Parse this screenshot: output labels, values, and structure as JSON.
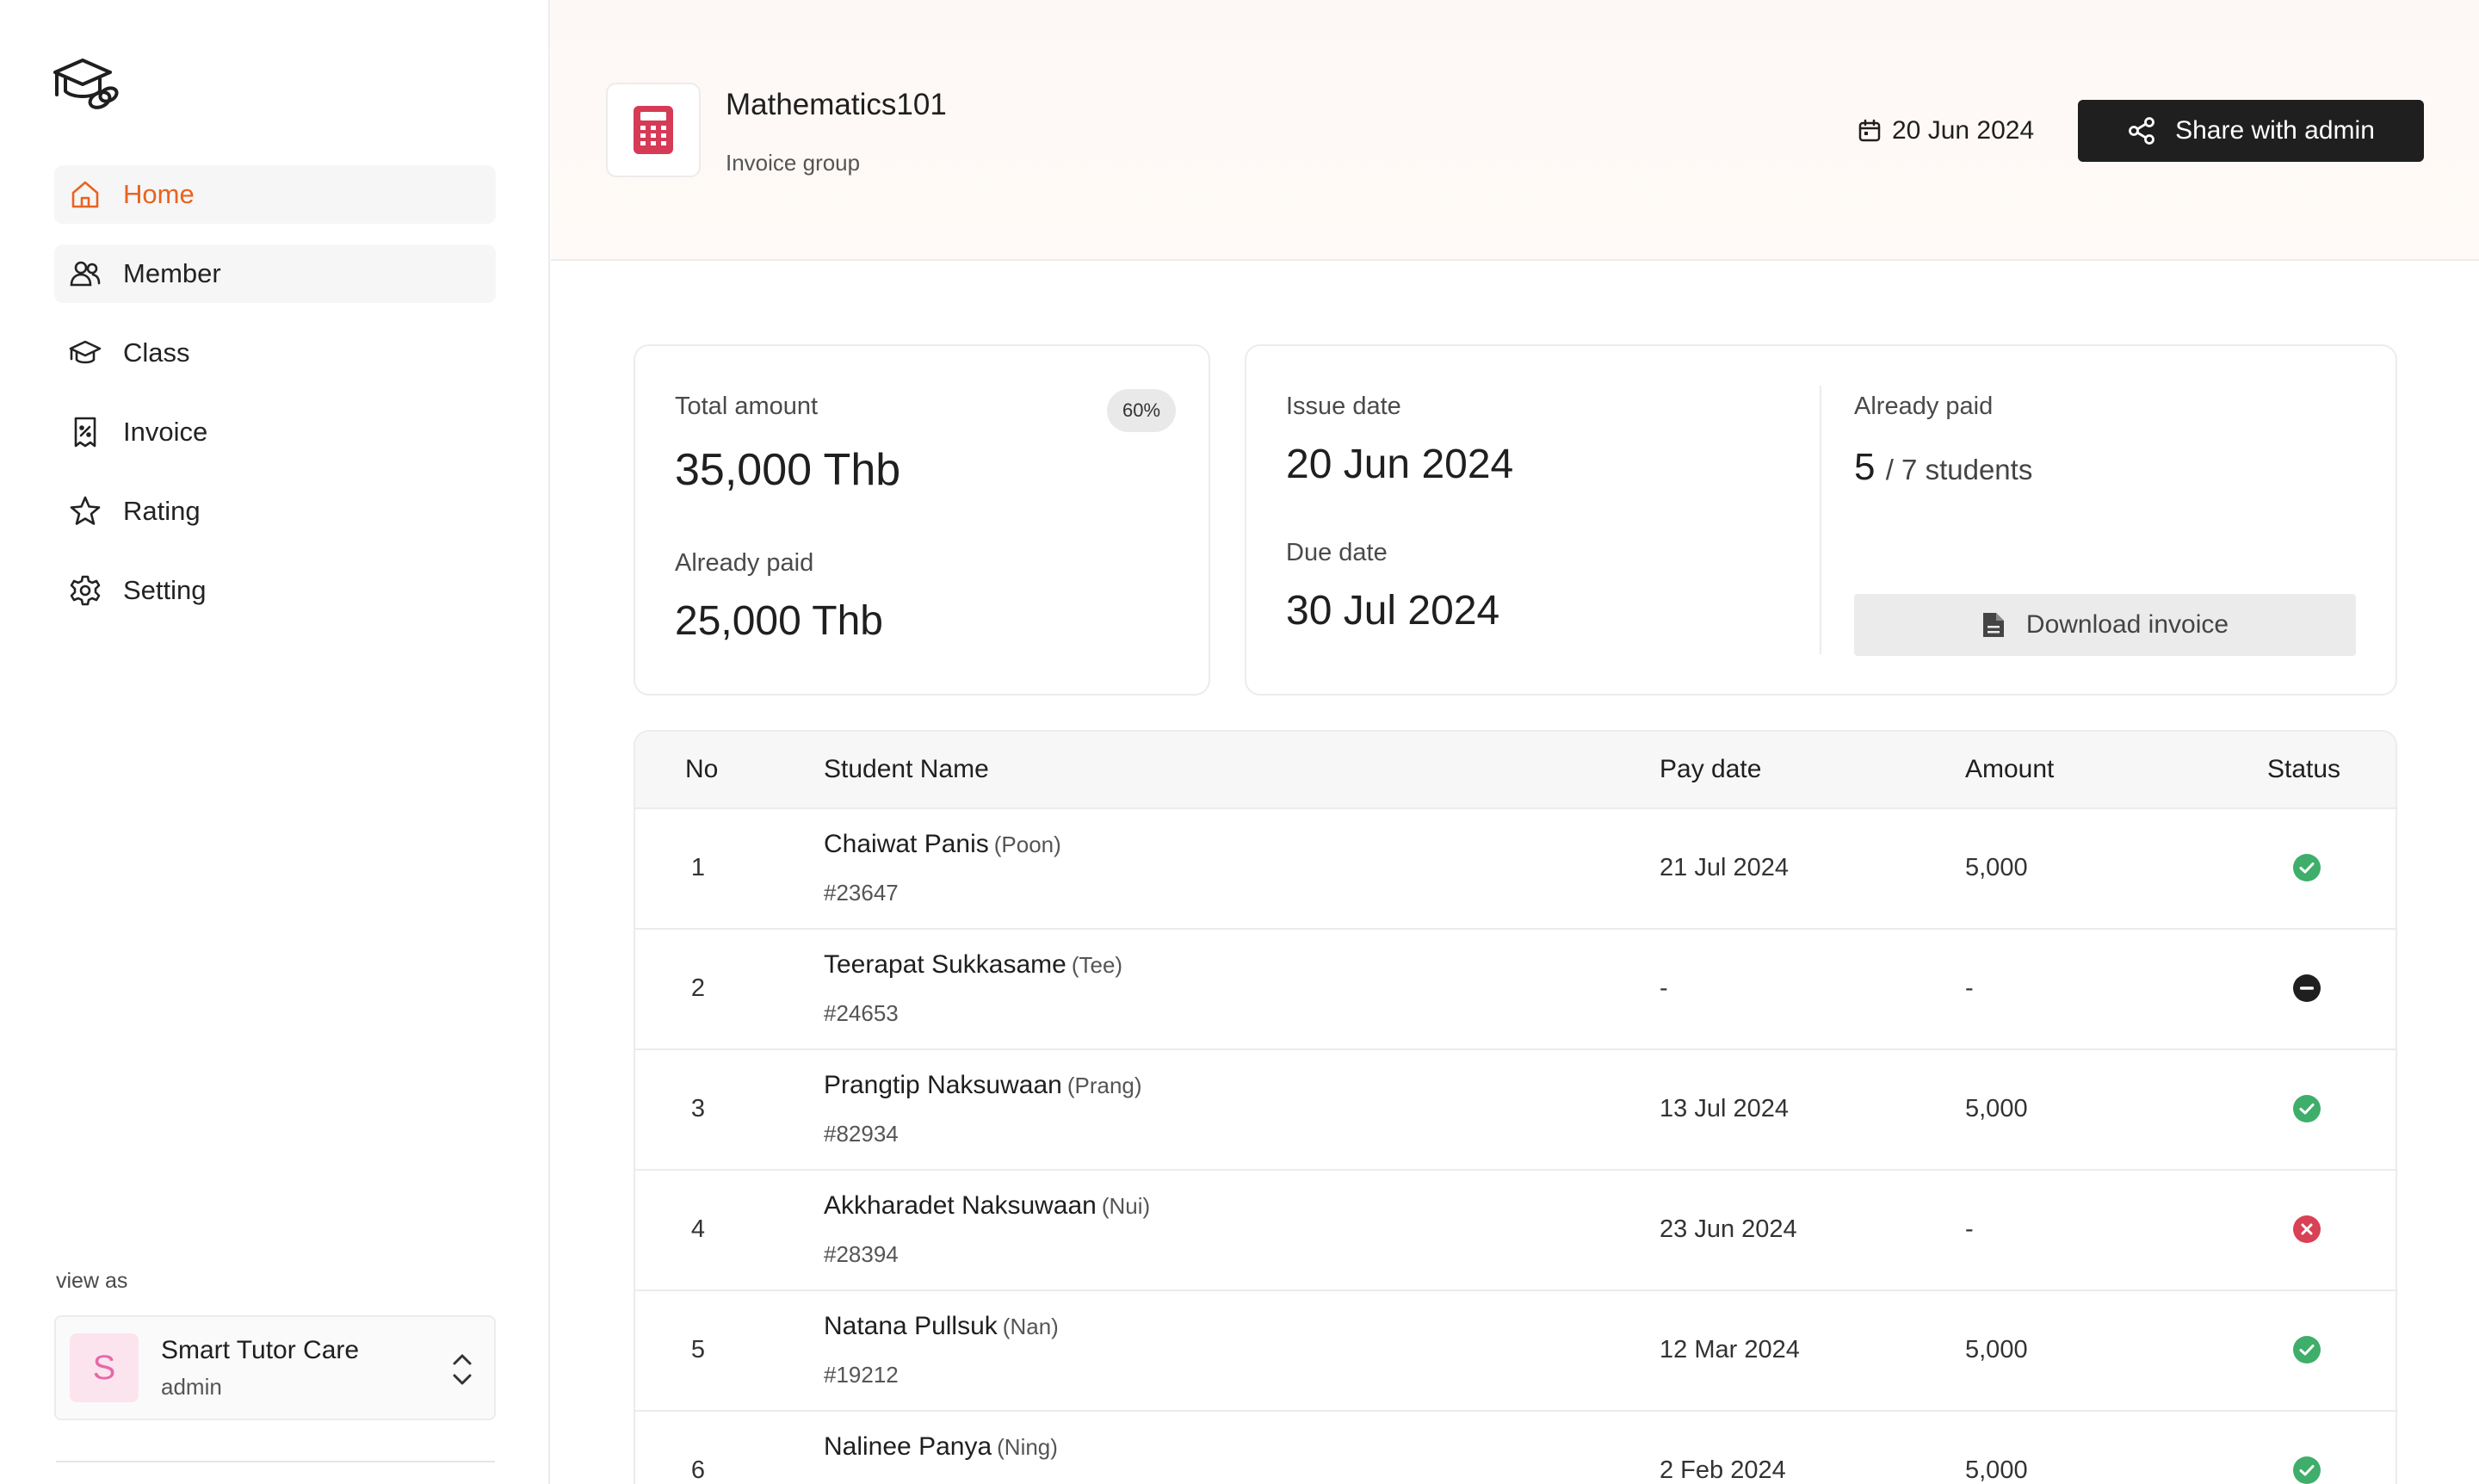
{
  "sidebar": {
    "logo_icon": "graduation-cap-icon",
    "items": [
      {
        "label": "Home",
        "icon": "home-icon",
        "state": "active"
      },
      {
        "label": "Member",
        "icon": "users-icon",
        "state": "hover"
      },
      {
        "label": "Class",
        "icon": "graduation-cap-icon",
        "state": ""
      },
      {
        "label": "Invoice",
        "icon": "receipt-icon",
        "state": ""
      },
      {
        "label": "Rating",
        "icon": "star-icon",
        "state": ""
      },
      {
        "label": "Setting",
        "icon": "gear-icon",
        "state": ""
      }
    ],
    "view_as_label": "view as",
    "account": {
      "initial": "S",
      "name": "Smart Tutor Care",
      "role": "admin"
    }
  },
  "header": {
    "title": "Mathematics101",
    "subtitle": "Invoice group",
    "date": "20 Jun 2024",
    "share_label": "Share with admin"
  },
  "summary": {
    "total_label": "Total amount",
    "percent_badge": "60%",
    "total_value": "35,000 Thb",
    "paid_label": "Already paid",
    "paid_value": "25,000 Thb",
    "issue_label": "Issue date",
    "issue_value": "20 Jun 2024",
    "due_label": "Due date",
    "due_value": "30 Jul 2024",
    "students_label": "Already paid",
    "students_paid": "5",
    "students_suffix": "/ 7 students",
    "download_label": "Download invoice"
  },
  "table": {
    "headers": {
      "no": "No",
      "name": "Student Name",
      "pay_date": "Pay date",
      "amount": "Amount",
      "status": "Status"
    },
    "rows": [
      {
        "no": "1",
        "name": "Chaiwat Panis",
        "nick": "(Poon)",
        "id": "#23647",
        "pay_date": "21 Jul 2024",
        "amount": "5,000",
        "status": "paid"
      },
      {
        "no": "2",
        "name": "Teerapat Sukkasame",
        "nick": "(Tee)",
        "id": "#24653",
        "pay_date": "-",
        "amount": "-",
        "status": "pending"
      },
      {
        "no": "3",
        "name": "Prangtip Naksuwaan",
        "nick": "(Prang)",
        "id": "#82934",
        "pay_date": "13 Jul 2024",
        "amount": "5,000",
        "status": "paid"
      },
      {
        "no": "4",
        "name": "Akkharadet Naksuwaan",
        "nick": "(Nui)",
        "id": "#28394",
        "pay_date": "23 Jun 2024",
        "amount": "-",
        "status": "failed"
      },
      {
        "no": "5",
        "name": "Natana Pullsuk",
        "nick": "(Nan)",
        "id": "#19212",
        "pay_date": "12 Mar 2024",
        "amount": "5,000",
        "status": "paid"
      },
      {
        "no": "6",
        "name": "Nalinee Panya",
        "nick": "(Ning)",
        "id": "",
        "pay_date": "2 Feb 2024",
        "amount": "5,000",
        "status": "paid"
      }
    ]
  },
  "colors": {
    "accent": "#e8631f",
    "brand_dark": "#1f1f1f",
    "calculator": "#d63a57",
    "status_paid": "#3fae6a",
    "status_pending": "#1f1f1f",
    "status_failed": "#d94155",
    "avatar_bg": "#fce4ef",
    "avatar_fg": "#e46aa8"
  }
}
